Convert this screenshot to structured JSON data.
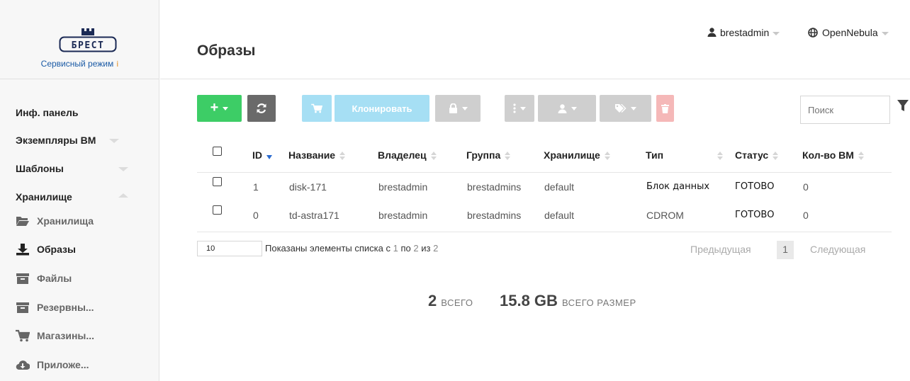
{
  "sidebar": {
    "logo_text": "БРЕСТ",
    "service_mode": "Сервисный режим",
    "info_glyph": "i",
    "nav": {
      "dashboard": "Инф. панель",
      "vms": "Экземпляры ВМ",
      "templates": "Шаблоны",
      "storage": "Хранилище"
    },
    "sub": {
      "datastores": "Хранилища",
      "images": "Образы",
      "files": "Файлы",
      "backups": "Резервны...",
      "marketplaces": "Магазины...",
      "apps": "Приложе..."
    }
  },
  "header": {
    "title": "Образы",
    "user": "brestadmin",
    "zone": "OpenNebula"
  },
  "toolbar": {
    "clone_label": "Клонировать",
    "search_placeholder": "Поиск"
  },
  "table": {
    "headers": {
      "id": "ID",
      "name": "Название",
      "owner": "Владелец",
      "group": "Группа",
      "datastore": "Хранилище",
      "type": "Тип",
      "status": "Статус",
      "vms": "Кол-во ВМ"
    },
    "rows": [
      {
        "id": "1",
        "name": "disk-171",
        "owner": "brestadmin",
        "group": "brestadmins",
        "datastore": "default",
        "type": "Блок данных",
        "status": "ГОТОВО",
        "vms": "0"
      },
      {
        "id": "0",
        "name": "td-astra171",
        "owner": "brestadmin",
        "group": "brestadmins",
        "datastore": "default",
        "type": "CDROM",
        "status": "ГОТОВО",
        "vms": "0"
      }
    ]
  },
  "footer": {
    "page_size": "10",
    "info_prefix": "Показаны элементы списка с",
    "from": "1",
    "to_word": "по",
    "to": "2",
    "of_word": "из",
    "total": "2",
    "prev": "Предыдущая",
    "current_page": "1",
    "next": "Следующая"
  },
  "totals": {
    "count": "2",
    "count_label": "ВСЕГО",
    "size": "15.8 GB",
    "size_label": "ВСЕГО РАЗМЕР"
  },
  "colors": {
    "create": "#3dcd66",
    "refresh": "#6a6a6a",
    "disabled_blue": "#a6dff4",
    "disabled_gray": "#cfcfcf",
    "disabled_red": "#f5b8b8",
    "link": "#1a5aa5",
    "sort_active": "#2a6bd0"
  }
}
